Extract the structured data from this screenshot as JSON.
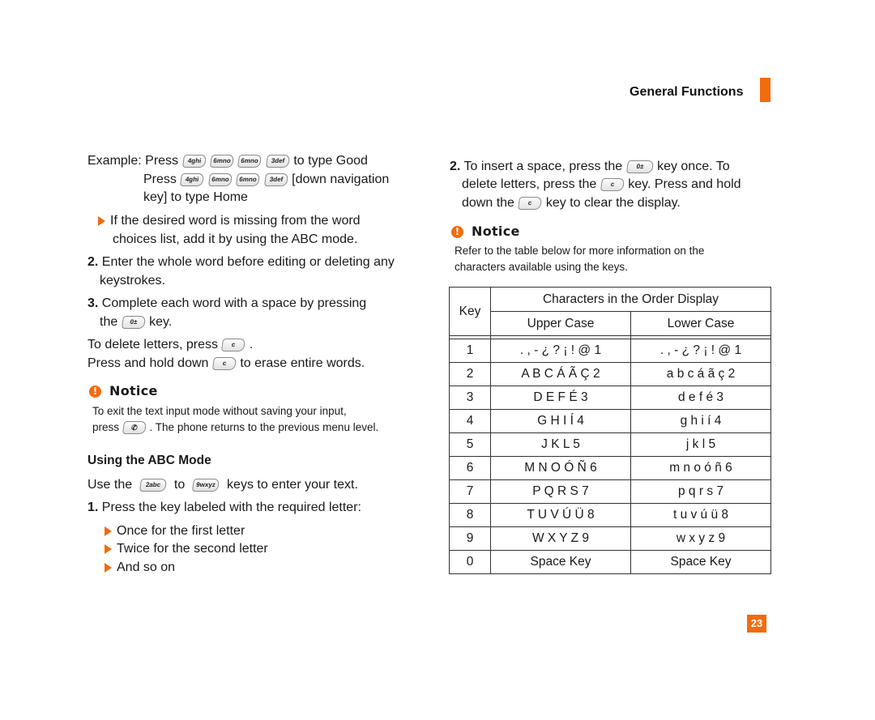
{
  "header": {
    "section_title": "General Functions",
    "accent_color": "#f26b0f"
  },
  "left": {
    "example": {
      "label": "Example:",
      "line1_press": "Press",
      "line1_keys": [
        "4ghi",
        "6mno",
        "6mno",
        "3def"
      ],
      "line1_suffix": "to type Good",
      "line2_press": "Press",
      "line2_keys": [
        "4ghi",
        "6mno",
        "6mno",
        "3def"
      ],
      "line2_suffix": "[down navigation",
      "line3": "key] to type Home"
    },
    "bullet_missing_word": {
      "line1": "If the desired word is missing from the word",
      "line2": "choices list, add it by using the ABC mode."
    },
    "step2": {
      "num": "2.",
      "line1": "Enter the whole word before editing or deleting any",
      "line2": "keystrokes."
    },
    "step3": {
      "num": "3.",
      "line1": "Complete each word with a space by pressing",
      "line2_prefix": "the",
      "line2_key": "0±",
      "line2_suffix": "key."
    },
    "delete_letters": {
      "prefix": "To delete letters, press",
      "key": "c",
      "suffix": "."
    },
    "erase_words": {
      "prefix": "Press and hold down",
      "key": "c",
      "suffix": "to erase entire words."
    },
    "notice": {
      "icon": "!",
      "title": "Notice",
      "line1": "To exit the text input mode without saving your input,",
      "line2_prefix": "press",
      "line2_key": "end-call-icon",
      "line2_suffix": ". The phone returns to the previous menu level."
    },
    "abc_mode": {
      "heading": "Using the ABC Mode",
      "use_prefix": "Use the",
      "key_from": "2abc",
      "to": "to",
      "key_to": "9wxyz",
      "use_suffix": "keys to enter your text.",
      "step1_num": "1.",
      "step1": "Press the key labeled with the required letter:",
      "bullets": [
        "Once for the first letter",
        "Twice for the second letter",
        "And so on"
      ]
    }
  },
  "right": {
    "step2": {
      "num": "2.",
      "line1_prefix": "To insert a space, press the",
      "line1_key": "0±",
      "line1_suffix": "key once. To",
      "line2_prefix": "delete letters, press the",
      "line2_key": "c",
      "line2_suffix": "key. Press and hold",
      "line3_prefix": "down the",
      "line3_key": "c",
      "line3_suffix": "key to clear the display."
    },
    "notice": {
      "icon": "!",
      "title": "Notice",
      "line1": "Refer to the table below for more information on the",
      "line2": "characters available using the keys."
    },
    "table": {
      "key_header": "Key",
      "group_header": "Characters in the Order Display",
      "upper_header": "Upper Case",
      "lower_header": "Lower Case",
      "rows": [
        {
          "key": "1",
          "upper": ". , - ¿ ? ¡ ! @ 1",
          "lower": ". , - ¿ ? ¡ ! @ 1"
        },
        {
          "key": "2",
          "upper": "A B C Á Ã Ç 2",
          "lower": "a b c á ã ç 2"
        },
        {
          "key": "3",
          "upper": "D E F É 3",
          "lower": "d e f é 3"
        },
        {
          "key": "4",
          "upper": "G H I Í 4",
          "lower": "g h i í 4"
        },
        {
          "key": "5",
          "upper": "J K L 5",
          "lower": "j k l 5"
        },
        {
          "key": "6",
          "upper": "M N O Ó Ñ 6",
          "lower": "m n o ó ñ 6"
        },
        {
          "key": "7",
          "upper": "P Q R S 7",
          "lower": "p q r s 7"
        },
        {
          "key": "8",
          "upper": "T U V Ú Ü 8",
          "lower": "t u v ú ü 8"
        },
        {
          "key": "9",
          "upper": "W X Y Z 9",
          "lower": "w x y z 9"
        },
        {
          "key": "0",
          "upper": "Space Key",
          "lower": "Space Key"
        }
      ]
    }
  },
  "footer": {
    "page_number": "23"
  }
}
